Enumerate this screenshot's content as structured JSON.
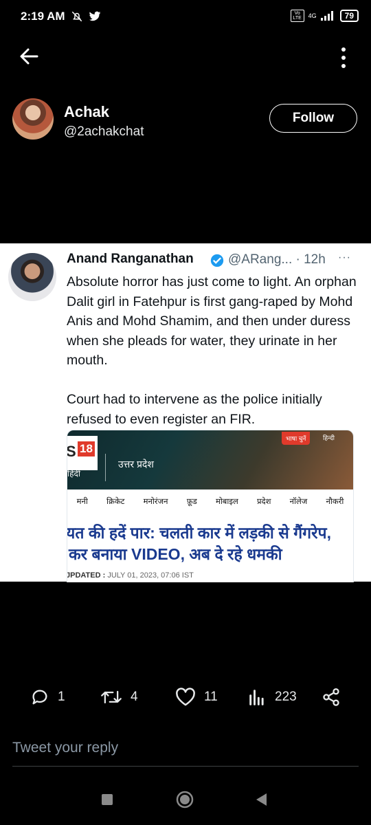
{
  "status_bar": {
    "time": "2:19 AM",
    "network": "4G",
    "volte": "Vo LTE",
    "battery": "79",
    "icons": [
      "mute-icon",
      "twitter-bird-icon",
      "signal-icon",
      "battery-icon"
    ]
  },
  "header": {
    "back_icon": "arrow-left-icon",
    "more_icon": "vertical-dots-icon"
  },
  "profile": {
    "name": "Achak",
    "handle": "@2achakchat",
    "follow_label": "Follow"
  },
  "quoted_tweet": {
    "author_name": "Anand Ranganathan",
    "author_handle": "@ARang...",
    "time": "· 12h",
    "more": "···",
    "verified_color": "#1d9bf0",
    "text": "Absolute horror has just come to light. An orphan Dalit girl in Fatehpur is first gang-raped by Mohd Anis and Mohd Shamim, and then under duress when she pleads for water, they urinate in her mouth.\n\nCourt had to intervene as the police initially refused to even register an FIR.",
    "news_card": {
      "logo_s": "S",
      "logo_18": "18",
      "logo_hindi": "हिंदी",
      "state": "उत्तर प्रदेश",
      "lang_pill": "भाषा चुनें",
      "lang_hindi": "हिन्दी",
      "nav": [
        "मनी",
        "क्रिकेट",
        "मनोरंजन",
        "फ़ूड",
        "मोबाइल",
        "प्रदेश",
        "नॉलेज",
        "नौकरी"
      ],
      "headline_line1": "यत की हदें पार: चलती कार में लड़की से गैंगरेप,",
      "headline_line2": "कर बनाया VIDEO, अब दे रहे धमकी",
      "updated_label": "JPDATED :",
      "updated_value": "JULY 01, 2023, 07:06 IST"
    }
  },
  "actions": {
    "reply_count": "1",
    "retweet_count": "4",
    "like_count": "11",
    "views_count": "223"
  },
  "reply_box": {
    "placeholder": "Tweet your reply"
  },
  "accent_color": "#1d9bf0"
}
